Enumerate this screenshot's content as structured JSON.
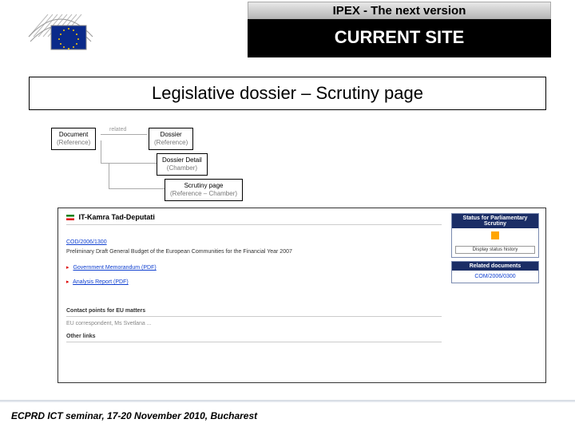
{
  "header": {
    "gray_title": "IPEX - The next version",
    "black_title": "CURRENT SITE"
  },
  "main_heading": "Legislative dossier – Scrutiny page",
  "crumbs": {
    "c1": {
      "l1": "Document",
      "l2": "(Reference)"
    },
    "c2": {
      "l1": "Dossier",
      "l2": "(Reference)"
    },
    "c3": {
      "l1": "Dossier Detail",
      "l2": "(Chamber)"
    },
    "c4": {
      "l1": "Scrutiny page",
      "l2": "(Reference – Chamber)"
    }
  },
  "shot": {
    "title_prefix": "IT-Kamra Tad-Deputati",
    "ref": "COD/2006/1300",
    "ref_desc": "Preliminary Draft General Budget of the European Communities for the Financial Year 2007",
    "mem": "Government Memorandum (PDF)",
    "anal": "Analysis Report (PDF)",
    "contacts_h": "Contact points for EU matters",
    "contacts_sub": "EU correspondent, Ms Svetlana ...",
    "other_h": "Other links",
    "status_h": "Status for Parliamentary Scrutiny",
    "btn": "Display status history",
    "rel_h": "Related documents",
    "rel_item": "COM/2006/0300"
  },
  "footer": "ECPRD ICT seminar, 17-20 November 2010, Bucharest"
}
